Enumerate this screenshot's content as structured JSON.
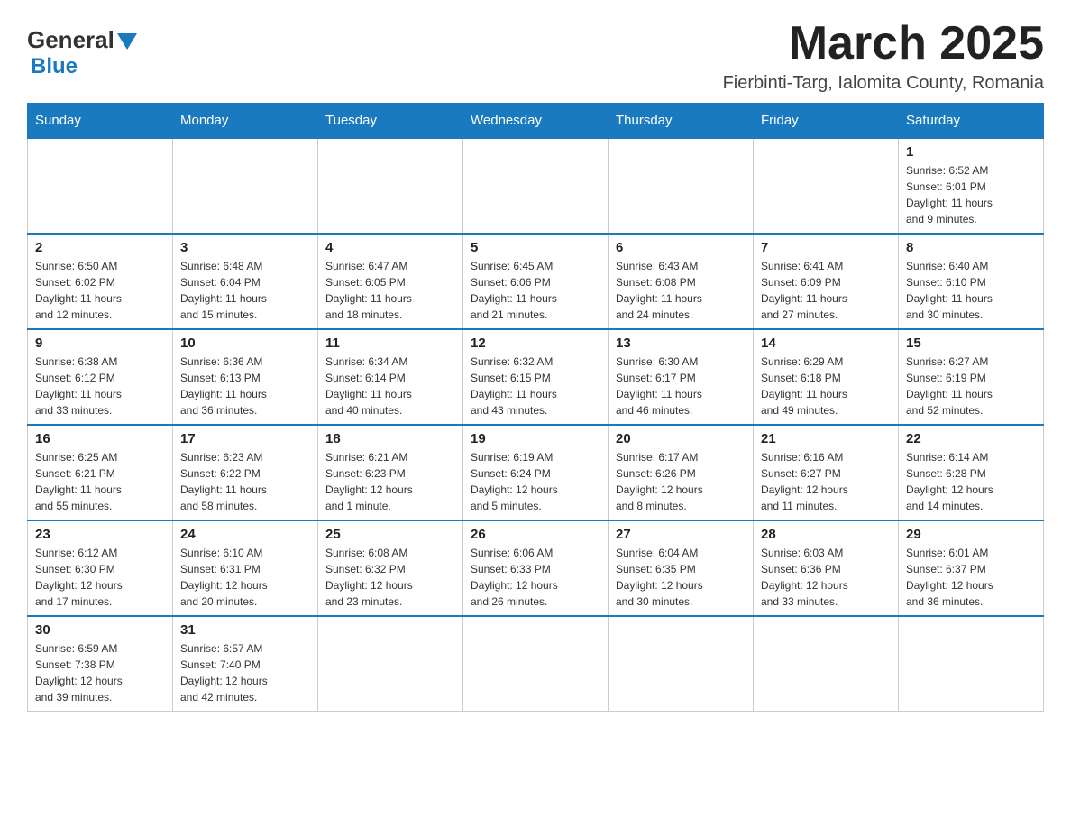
{
  "header": {
    "logo_text_general": "General",
    "logo_text_blue": "Blue",
    "month_year": "March 2025",
    "location": "Fierbinti-Targ, Ialomita County, Romania"
  },
  "days_of_week": [
    "Sunday",
    "Monday",
    "Tuesday",
    "Wednesday",
    "Thursday",
    "Friday",
    "Saturday"
  ],
  "weeks": [
    [
      {
        "day": "",
        "info": ""
      },
      {
        "day": "",
        "info": ""
      },
      {
        "day": "",
        "info": ""
      },
      {
        "day": "",
        "info": ""
      },
      {
        "day": "",
        "info": ""
      },
      {
        "day": "",
        "info": ""
      },
      {
        "day": "1",
        "info": "Sunrise: 6:52 AM\nSunset: 6:01 PM\nDaylight: 11 hours\nand 9 minutes."
      }
    ],
    [
      {
        "day": "2",
        "info": "Sunrise: 6:50 AM\nSunset: 6:02 PM\nDaylight: 11 hours\nand 12 minutes."
      },
      {
        "day": "3",
        "info": "Sunrise: 6:48 AM\nSunset: 6:04 PM\nDaylight: 11 hours\nand 15 minutes."
      },
      {
        "day": "4",
        "info": "Sunrise: 6:47 AM\nSunset: 6:05 PM\nDaylight: 11 hours\nand 18 minutes."
      },
      {
        "day": "5",
        "info": "Sunrise: 6:45 AM\nSunset: 6:06 PM\nDaylight: 11 hours\nand 21 minutes."
      },
      {
        "day": "6",
        "info": "Sunrise: 6:43 AM\nSunset: 6:08 PM\nDaylight: 11 hours\nand 24 minutes."
      },
      {
        "day": "7",
        "info": "Sunrise: 6:41 AM\nSunset: 6:09 PM\nDaylight: 11 hours\nand 27 minutes."
      },
      {
        "day": "8",
        "info": "Sunrise: 6:40 AM\nSunset: 6:10 PM\nDaylight: 11 hours\nand 30 minutes."
      }
    ],
    [
      {
        "day": "9",
        "info": "Sunrise: 6:38 AM\nSunset: 6:12 PM\nDaylight: 11 hours\nand 33 minutes."
      },
      {
        "day": "10",
        "info": "Sunrise: 6:36 AM\nSunset: 6:13 PM\nDaylight: 11 hours\nand 36 minutes."
      },
      {
        "day": "11",
        "info": "Sunrise: 6:34 AM\nSunset: 6:14 PM\nDaylight: 11 hours\nand 40 minutes."
      },
      {
        "day": "12",
        "info": "Sunrise: 6:32 AM\nSunset: 6:15 PM\nDaylight: 11 hours\nand 43 minutes."
      },
      {
        "day": "13",
        "info": "Sunrise: 6:30 AM\nSunset: 6:17 PM\nDaylight: 11 hours\nand 46 minutes."
      },
      {
        "day": "14",
        "info": "Sunrise: 6:29 AM\nSunset: 6:18 PM\nDaylight: 11 hours\nand 49 minutes."
      },
      {
        "day": "15",
        "info": "Sunrise: 6:27 AM\nSunset: 6:19 PM\nDaylight: 11 hours\nand 52 minutes."
      }
    ],
    [
      {
        "day": "16",
        "info": "Sunrise: 6:25 AM\nSunset: 6:21 PM\nDaylight: 11 hours\nand 55 minutes."
      },
      {
        "day": "17",
        "info": "Sunrise: 6:23 AM\nSunset: 6:22 PM\nDaylight: 11 hours\nand 58 minutes."
      },
      {
        "day": "18",
        "info": "Sunrise: 6:21 AM\nSunset: 6:23 PM\nDaylight: 12 hours\nand 1 minute."
      },
      {
        "day": "19",
        "info": "Sunrise: 6:19 AM\nSunset: 6:24 PM\nDaylight: 12 hours\nand 5 minutes."
      },
      {
        "day": "20",
        "info": "Sunrise: 6:17 AM\nSunset: 6:26 PM\nDaylight: 12 hours\nand 8 minutes."
      },
      {
        "day": "21",
        "info": "Sunrise: 6:16 AM\nSunset: 6:27 PM\nDaylight: 12 hours\nand 11 minutes."
      },
      {
        "day": "22",
        "info": "Sunrise: 6:14 AM\nSunset: 6:28 PM\nDaylight: 12 hours\nand 14 minutes."
      }
    ],
    [
      {
        "day": "23",
        "info": "Sunrise: 6:12 AM\nSunset: 6:30 PM\nDaylight: 12 hours\nand 17 minutes."
      },
      {
        "day": "24",
        "info": "Sunrise: 6:10 AM\nSunset: 6:31 PM\nDaylight: 12 hours\nand 20 minutes."
      },
      {
        "day": "25",
        "info": "Sunrise: 6:08 AM\nSunset: 6:32 PM\nDaylight: 12 hours\nand 23 minutes."
      },
      {
        "day": "26",
        "info": "Sunrise: 6:06 AM\nSunset: 6:33 PM\nDaylight: 12 hours\nand 26 minutes."
      },
      {
        "day": "27",
        "info": "Sunrise: 6:04 AM\nSunset: 6:35 PM\nDaylight: 12 hours\nand 30 minutes."
      },
      {
        "day": "28",
        "info": "Sunrise: 6:03 AM\nSunset: 6:36 PM\nDaylight: 12 hours\nand 33 minutes."
      },
      {
        "day": "29",
        "info": "Sunrise: 6:01 AM\nSunset: 6:37 PM\nDaylight: 12 hours\nand 36 minutes."
      }
    ],
    [
      {
        "day": "30",
        "info": "Sunrise: 6:59 AM\nSunset: 7:38 PM\nDaylight: 12 hours\nand 39 minutes."
      },
      {
        "day": "31",
        "info": "Sunrise: 6:57 AM\nSunset: 7:40 PM\nDaylight: 12 hours\nand 42 minutes."
      },
      {
        "day": "",
        "info": ""
      },
      {
        "day": "",
        "info": ""
      },
      {
        "day": "",
        "info": ""
      },
      {
        "day": "",
        "info": ""
      },
      {
        "day": "",
        "info": ""
      }
    ]
  ]
}
